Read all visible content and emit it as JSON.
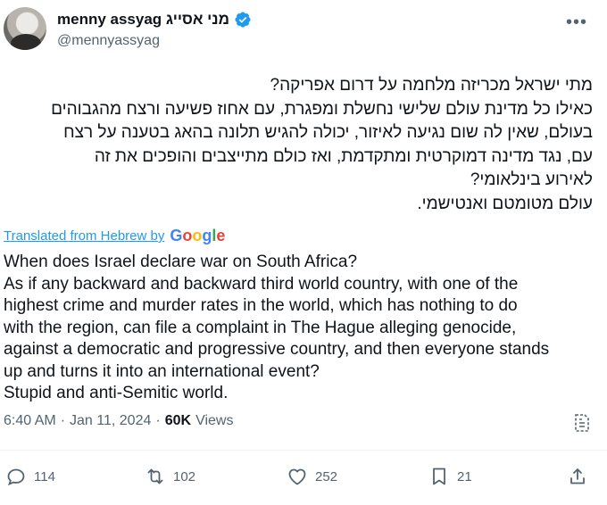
{
  "tweet": {
    "display_name": "menny assyag מני אסייג",
    "handle": "@mennyassyag",
    "hebrew_lines": [
      "מתי ישראל מכריזה מלחמה על דרום אפריקה?",
      "כאילו כל מדינת עולם שלישי נחשלת ומפגרת, עם אחוז פשיעה ורצח מהגבוהים",
      "בעולם, שאין לה שום נגיעה לאיזור, יכולה להגיש תלונה בהאג בטענה על רצח",
      "עם, נגד מדינה דמוקרטית ומתקדמת, ואז כולם מתייצבים והופכים את זה",
      "לאירוע בינלאומי?",
      "עולם מטומטם ואנטישמי."
    ],
    "translated_label": "Translated from Hebrew by",
    "google_label": "Google",
    "english_lines": [
      "When does Israel declare war on South Africa?",
      "As if any backward and backward third world country, with one of the",
      "highest crime and murder rates in the world, which has nothing to do",
      "with the region, can file a complaint in The Hague alleging genocide,",
      "against a democratic and progressive country, and then everyone stands",
      "up and turns it into an international event?",
      "Stupid and anti-Semitic world."
    ],
    "time": "6:40 AM",
    "date": "Jan 11, 2024",
    "views_count": "60K",
    "views_label": "Views"
  },
  "actions": {
    "replies": "114",
    "reposts": "102",
    "likes": "252",
    "bookmarks": "21"
  },
  "colors": {
    "verified": "#1d9bf0",
    "link": "#1d9bf0",
    "muted": "#536471"
  }
}
